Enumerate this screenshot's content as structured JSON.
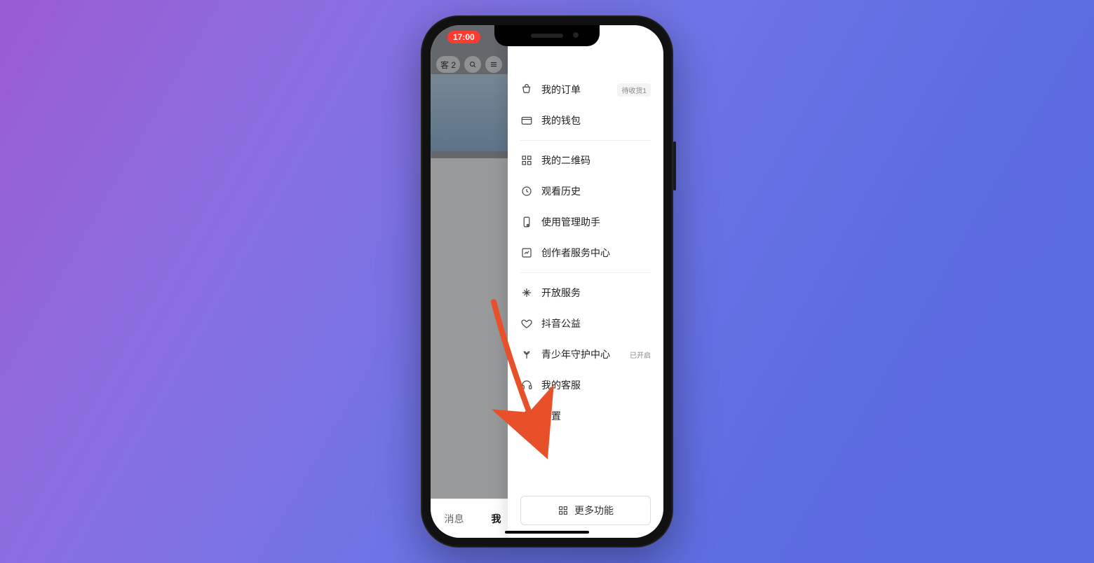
{
  "status": {
    "time": "17:00"
  },
  "background": {
    "friends_count": "客 2",
    "tabs": {
      "messages": "消息",
      "me": "我"
    }
  },
  "drawer": {
    "my_orders": "我的订单",
    "my_orders_badge": "待收货1",
    "wallet": "我的钱包",
    "qrcode": "我的二维码",
    "watch_history": "观看历史",
    "mgmt_assistant": "使用管理助手",
    "creator_center": "创作者服务中心",
    "open_services": "开放服务",
    "charity": "抖音公益",
    "youth_center": "青少年守护中心",
    "youth_badge": "已开启",
    "customer_service": "我的客服",
    "settings": "设置",
    "more": "更多功能"
  }
}
